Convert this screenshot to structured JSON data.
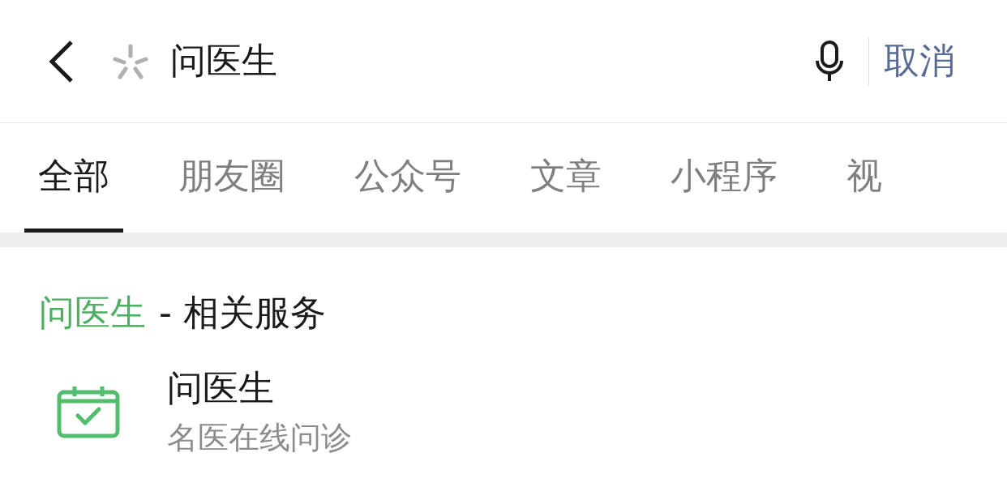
{
  "search": {
    "value": "问医生",
    "cancel": "取消"
  },
  "tabs": [
    {
      "label": "全部",
      "selected": true
    },
    {
      "label": "朋友圈",
      "selected": false
    },
    {
      "label": "公众号",
      "selected": false
    },
    {
      "label": "文章",
      "selected": false
    },
    {
      "label": "小程序",
      "selected": false
    },
    {
      "label": "视",
      "selected": false
    }
  ],
  "section": {
    "keyword": "问医生",
    "title": "- 相关服务"
  },
  "services": [
    {
      "title": "问医生",
      "subtitle": "名医在线问诊"
    }
  ]
}
